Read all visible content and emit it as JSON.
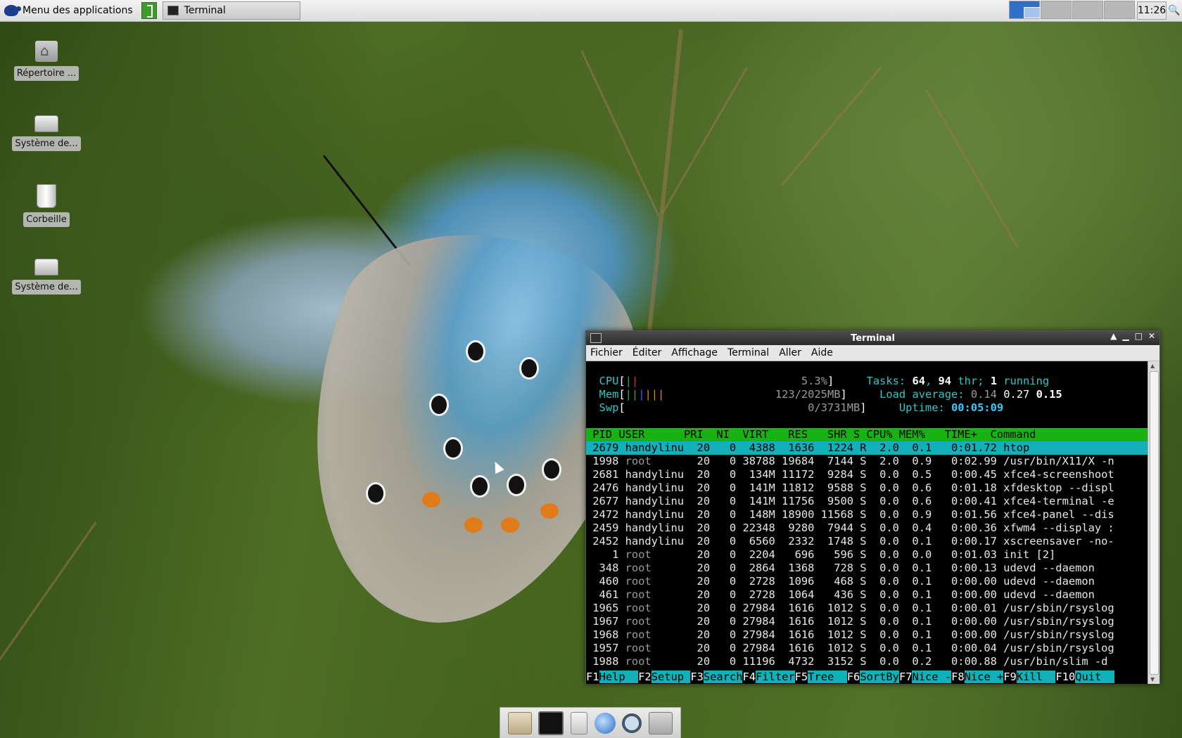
{
  "panel": {
    "apps_menu": "Menu des applications",
    "task_terminal": "Terminal",
    "clock": "11:26"
  },
  "desktop": {
    "icons": [
      {
        "label": "Répertoire ...",
        "icon": "home-folder-icon"
      },
      {
        "label": "Système de...",
        "icon": "drive-icon"
      },
      {
        "label": "Corbeille",
        "icon": "trash-icon"
      },
      {
        "label": "Système de...",
        "icon": "drive-icon"
      }
    ]
  },
  "terminal": {
    "title": "Terminal",
    "menu": [
      "Fichier",
      "Éditer",
      "Affichage",
      "Terminal",
      "Aller",
      "Aide"
    ],
    "meters": {
      "cpu_label": "CPU",
      "cpu_value": "5.3%",
      "mem_label": "Mem",
      "mem_value": "123/2025MB",
      "swp_label": "Swp",
      "swp_value": "0/3731MB"
    },
    "stats": {
      "tasks_label": "Tasks: ",
      "tasks": "64",
      "thr": "94",
      "thr_label": " thr; ",
      "running": "1",
      "running_label": " running",
      "load_label": "Load average: ",
      "load1": "0.14",
      "load5": "0.27",
      "load15": "0.15",
      "uptime_label": "Uptime: ",
      "uptime": "00:05:09"
    },
    "header": " PID USER      PRI  NI  VIRT   RES   SHR S CPU% MEM%   TIME+  Command                        ",
    "rows": [
      {
        "pid": "2679",
        "user": "handylinu",
        "pri": "20",
        "ni": "0",
        "virt": "4388",
        "res": "1636",
        "shr": "1224",
        "s": "R",
        "cpu": "2.0",
        "mem": "0.1",
        "time": "0:01.72",
        "cmd": "htop"
      },
      {
        "pid": "1998",
        "user": "root",
        "pri": "20",
        "ni": "0",
        "virt": "38788",
        "res": "19684",
        "shr": "7144",
        "s": "S",
        "cpu": "2.0",
        "mem": "0.9",
        "time": "0:02.99",
        "cmd": "/usr/bin/X11/X -n"
      },
      {
        "pid": "2681",
        "user": "handylinu",
        "pri": "20",
        "ni": "0",
        "virt": "134M",
        "res": "11172",
        "shr": "9284",
        "s": "S",
        "cpu": "0.0",
        "mem": "0.5",
        "time": "0:00.45",
        "cmd": "xfce4-screenshoot"
      },
      {
        "pid": "2476",
        "user": "handylinu",
        "pri": "20",
        "ni": "0",
        "virt": "141M",
        "res": "11812",
        "shr": "9588",
        "s": "S",
        "cpu": "0.0",
        "mem": "0.6",
        "time": "0:01.18",
        "cmd": "xfdesktop --displ"
      },
      {
        "pid": "2677",
        "user": "handylinu",
        "pri": "20",
        "ni": "0",
        "virt": "141M",
        "res": "11756",
        "shr": "9500",
        "s": "S",
        "cpu": "0.0",
        "mem": "0.6",
        "time": "0:00.41",
        "cmd": "xfce4-terminal -e"
      },
      {
        "pid": "2472",
        "user": "handylinu",
        "pri": "20",
        "ni": "0",
        "virt": "148M",
        "res": "18900",
        "shr": "11568",
        "s": "S",
        "cpu": "0.0",
        "mem": "0.9",
        "time": "0:01.56",
        "cmd": "xfce4-panel --dis"
      },
      {
        "pid": "2459",
        "user": "handylinu",
        "pri": "20",
        "ni": "0",
        "virt": "22348",
        "res": "9280",
        "shr": "7944",
        "s": "S",
        "cpu": "0.0",
        "mem": "0.4",
        "time": "0:00.36",
        "cmd": "xfwm4 --display :"
      },
      {
        "pid": "2452",
        "user": "handylinu",
        "pri": "20",
        "ni": "0",
        "virt": "6560",
        "res": "2332",
        "shr": "1748",
        "s": "S",
        "cpu": "0.0",
        "mem": "0.1",
        "time": "0:00.17",
        "cmd": "xscreensaver -no-"
      },
      {
        "pid": "1",
        "user": "root",
        "pri": "20",
        "ni": "0",
        "virt": "2204",
        "res": "696",
        "shr": "596",
        "s": "S",
        "cpu": "0.0",
        "mem": "0.0",
        "time": "0:01.03",
        "cmd": "init [2]"
      },
      {
        "pid": "348",
        "user": "root",
        "pri": "20",
        "ni": "0",
        "virt": "2864",
        "res": "1368",
        "shr": "728",
        "s": "S",
        "cpu": "0.0",
        "mem": "0.1",
        "time": "0:00.13",
        "cmd": "udevd --daemon"
      },
      {
        "pid": "460",
        "user": "root",
        "pri": "20",
        "ni": "0",
        "virt": "2728",
        "res": "1096",
        "shr": "468",
        "s": "S",
        "cpu": "0.0",
        "mem": "0.1",
        "time": "0:00.00",
        "cmd": "udevd --daemon"
      },
      {
        "pid": "461",
        "user": "root",
        "pri": "20",
        "ni": "0",
        "virt": "2728",
        "res": "1064",
        "shr": "436",
        "s": "S",
        "cpu": "0.0",
        "mem": "0.1",
        "time": "0:00.00",
        "cmd": "udevd --daemon"
      },
      {
        "pid": "1965",
        "user": "root",
        "pri": "20",
        "ni": "0",
        "virt": "27984",
        "res": "1616",
        "shr": "1012",
        "s": "S",
        "cpu": "0.0",
        "mem": "0.1",
        "time": "0:00.01",
        "cmd": "/usr/sbin/rsyslog"
      },
      {
        "pid": "1967",
        "user": "root",
        "pri": "20",
        "ni": "0",
        "virt": "27984",
        "res": "1616",
        "shr": "1012",
        "s": "S",
        "cpu": "0.0",
        "mem": "0.1",
        "time": "0:00.00",
        "cmd": "/usr/sbin/rsyslog"
      },
      {
        "pid": "1968",
        "user": "root",
        "pri": "20",
        "ni": "0",
        "virt": "27984",
        "res": "1616",
        "shr": "1012",
        "s": "S",
        "cpu": "0.0",
        "mem": "0.1",
        "time": "0:00.00",
        "cmd": "/usr/sbin/rsyslog"
      },
      {
        "pid": "1957",
        "user": "root",
        "pri": "20",
        "ni": "0",
        "virt": "27984",
        "res": "1616",
        "shr": "1012",
        "s": "S",
        "cpu": "0.0",
        "mem": "0.1",
        "time": "0:00.04",
        "cmd": "/usr/sbin/rsyslog"
      },
      {
        "pid": "1988",
        "user": "root",
        "pri": "20",
        "ni": "0",
        "virt": "11196",
        "res": "4732",
        "shr": "3152",
        "s": "S",
        "cpu": "0.0",
        "mem": "0.2",
        "time": "0:00.88",
        "cmd": "/usr/bin/slim -d"
      }
    ],
    "fkeys": [
      {
        "key": "F1",
        "label": "Help  "
      },
      {
        "key": "F2",
        "label": "Setup "
      },
      {
        "key": "F3",
        "label": "Search"
      },
      {
        "key": "F4",
        "label": "Filter"
      },
      {
        "key": "F5",
        "label": "Tree  "
      },
      {
        "key": "F6",
        "label": "SortBy"
      },
      {
        "key": "F7",
        "label": "Nice -"
      },
      {
        "key": "F8",
        "label": "Nice +"
      },
      {
        "key": "F9",
        "label": "Kill  "
      },
      {
        "key": "F10",
        "label": "Quit  "
      }
    ]
  },
  "colors": {
    "header_bg": "#16b313",
    "selected_bg": "#12b0b8",
    "workspace_active": "#2f6fc9"
  }
}
